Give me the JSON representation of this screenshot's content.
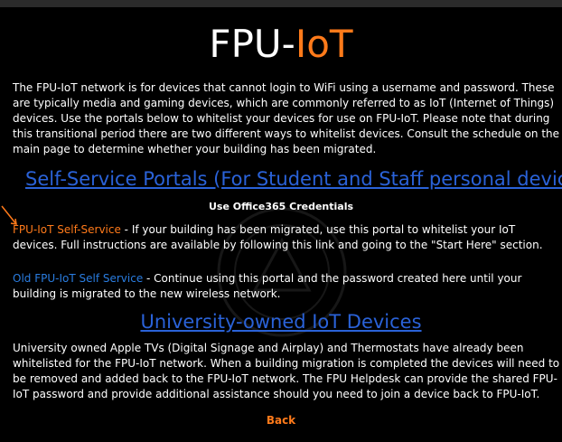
{
  "page": {
    "title_main": "FPU-",
    "title_accent": "IoT"
  },
  "intro": {
    "text": "The FPU-IoT network is for devices that cannot login to WiFi using a username and password. These are typically media and gaming devices, which are commonly referred to as IoT (Internet of Things) devices. Use the portals below to whitelist your devices for use on FPU-IoT. Please note that during this transitional period there are two different ways to whitelist devices. Consult the schedule on the main page to determine whether your building has been migrated."
  },
  "self_service": {
    "heading": "Self-Service Portals (For Student and Staff personal devices)",
    "credentials_note": "Use Office365 Credentials",
    "new_portal_link": "FPU-IoT Self-Service",
    "new_portal_text": " - If your building has been migrated, use this portal to whitelist your IoT devices. Full instructions are available by following this link and going to the \"Start Here\" section.",
    "old_portal_link": "Old FPU-IoT Self Service",
    "old_portal_text": " - Continue using this portal and the password created here until your building is migrated to the new wireless network."
  },
  "university": {
    "heading": "University-owned IoT Devices",
    "text": "University owned Apple TVs (Digital Signage and Airplay) and Thermostats have already been whitelisted for the FPU-IoT network. When a building migration is completed the devices will need to be removed and added back to the FPU-IoT network. The FPU Helpdesk can provide the shared FPU-IoT password and provide additional assistance should you need to join a device back to FPU-IoT."
  },
  "footer": {
    "back_label": "Back"
  },
  "colors": {
    "background": "#000000",
    "accent_orange": "#ff7a1a",
    "link_blue": "#2a62d8"
  }
}
